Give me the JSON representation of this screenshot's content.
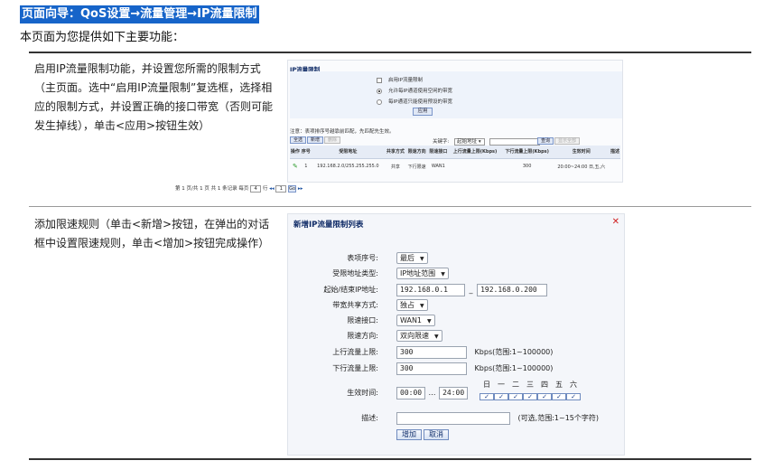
{
  "header": {
    "nav_path": "页面向导：QoS设置→流量管理→IP流量限制",
    "intro": "本页面为您提供如下主要功能："
  },
  "section1": {
    "description": "启用IP流量限制功能，并设置您所需的限制方式（主页面。选中“启用IP流量限制”复选框，选择相应的限制方式，并设置正确的接口带宽（否则可能发生掉线），单击<应用>按钮生效）",
    "panel": {
      "title": "IP流量限制",
      "enable_label": "启用IP流量限制",
      "option1_label": "允许每IP通道使用空闲的带宽",
      "option2_label": "每IP通道只能使用预设的带宽",
      "apply_label": "应用",
      "note": "注意：表项排序号越靠前匹配，先匹配先生效。",
      "add_label": "全选",
      "new_label": "新增",
      "delete_label": "删除",
      "keyword_label": "关键字:",
      "keyword_select": "起始地址",
      "search_label": "查询",
      "show_all_label": "显示全部",
      "table": {
        "headers": [
          "操作",
          "序号",
          "受限地址",
          "共享方式",
          "限速方向",
          "限速接口",
          "上行流量上限(Kbps)",
          "下行流量上限(Kbps)",
          "生效时间",
          "描述"
        ],
        "rows": [
          [
            "",
            "1",
            "192.168.2.0/255.255.255.0",
            "共享",
            "下行限速",
            "WAN1",
            "",
            "300",
            "20:00~24:00 日,五,六",
            ""
          ]
        ]
      },
      "pager": {
        "text_before": "第 1 页/共 1 页 共 1 条记录 每页",
        "per_page": "4",
        "text_mid": "行",
        "page_value": "1",
        "go_label": "Go"
      }
    }
  },
  "section2": {
    "description": "添加限速规则（单击<新增>按钮，在弹出的对话框中设置限速规则，单击<增加>按钮完成操作）",
    "dialog": {
      "title": "新增IP流量限制列表",
      "fields": {
        "seq_label": "表项序号:",
        "seq_value": "最后",
        "addr_type_label": "受限地址类型:",
        "addr_type_value": "IP地址范围",
        "ip_range_label": "起始/结束IP地址:",
        "ip_start": "192.168.0.1",
        "ip_end": "192.168.0.200",
        "share_label": "带宽共享方式:",
        "share_value": "独占",
        "iface_label": "限速接口:",
        "iface_value": "WAN1",
        "dir_label": "限速方向:",
        "dir_value": "双向限速",
        "up_label": "上行流量上限:",
        "up_value": "300",
        "up_unit": "Kbps(范围:1~100000)",
        "down_label": "下行流量上限:",
        "down_value": "300",
        "down_unit": "Kbps(范围:1~100000)",
        "time_label": "生效时间:",
        "time_start": "00:00",
        "time_end": "24:00",
        "days": [
          "日",
          "一",
          "二",
          "三",
          "四",
          "五",
          "六"
        ],
        "desc_label": "描述:",
        "desc_hint": "(可选,范围:1~15个字符)"
      },
      "add_label": "增加",
      "cancel_label": "取消"
    }
  }
}
